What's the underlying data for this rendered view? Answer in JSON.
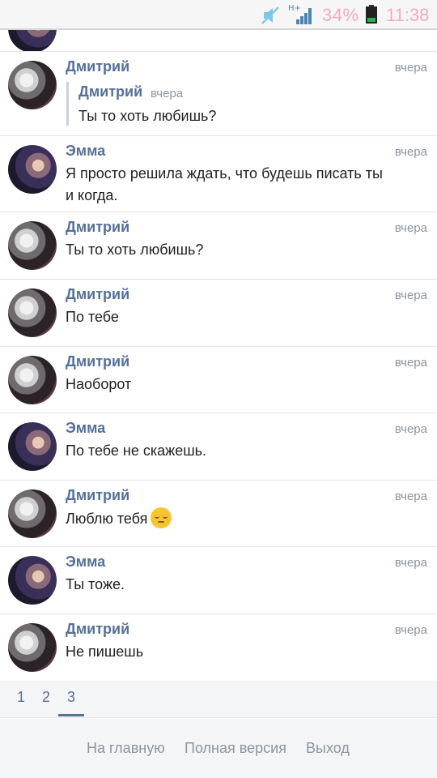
{
  "status_bar": {
    "network": "H+",
    "battery_percent": "34%",
    "time": "11:38",
    "icons": [
      "mute-icon",
      "signal-icon",
      "battery-icon"
    ],
    "accent_color": "#f4a9c2"
  },
  "quote": {
    "name": "Дмитрий",
    "time": "вчера",
    "text": "Ты то хоть любишь?"
  },
  "messages": [
    {
      "name": "Дмитрий",
      "time": "вчера",
      "text": "",
      "has_quote": true,
      "avatar": "dmitry"
    },
    {
      "name": "Эмма",
      "time": "вчера",
      "text": "Я просто решила ждать, что будешь писать ты и когда.",
      "avatar": "emma"
    },
    {
      "name": "Дмитрий",
      "time": "вчера",
      "text": "Ты то хоть любишь?",
      "avatar": "dmitry"
    },
    {
      "name": "Дмитрий",
      "time": "вчера",
      "text": "По тебе",
      "avatar": "dmitry"
    },
    {
      "name": "Дмитрий",
      "time": "вчера",
      "text": "Наоборот",
      "avatar": "dmitry"
    },
    {
      "name": "Эмма",
      "time": "вчера",
      "text": "По тебе не скажешь.",
      "avatar": "emma"
    },
    {
      "name": "Дмитрий",
      "time": "вчера",
      "text": "Люблю тебя",
      "emoji": "pensive-face",
      "avatar": "dmitry"
    },
    {
      "name": "Эмма",
      "time": "вчера",
      "text": "Ты тоже.",
      "avatar": "emma"
    },
    {
      "name": "Дмитрий",
      "time": "вчера",
      "text": "Не пишешь",
      "avatar": "dmitry"
    }
  ],
  "pagination": {
    "pages": [
      "1",
      "2",
      "3"
    ],
    "current": "3"
  },
  "footer": {
    "home": "На главную",
    "full_version": "Полная версия",
    "logout": "Выход"
  },
  "colors": {
    "name": "#55709b",
    "time": "#8c959e",
    "divider": "#e2e4e8"
  }
}
